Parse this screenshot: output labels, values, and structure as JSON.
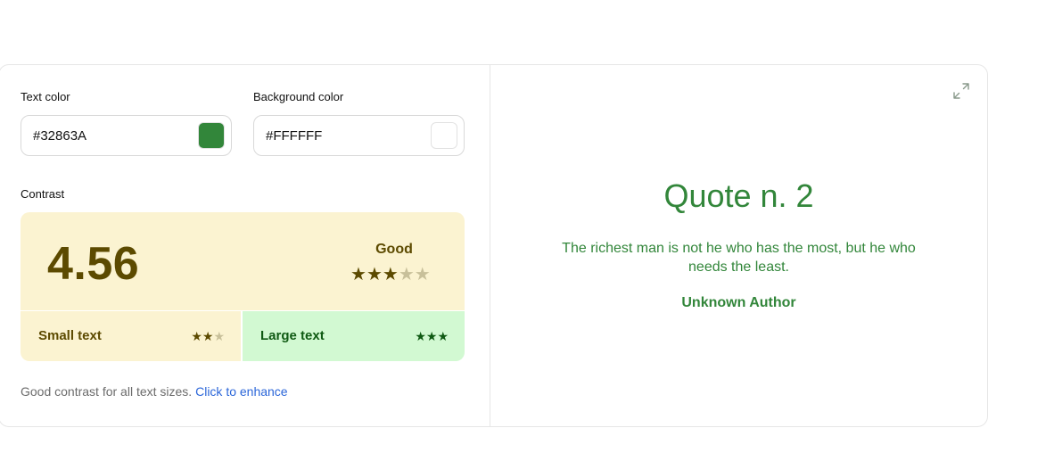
{
  "inputs": {
    "text_color_label": "Text color",
    "text_color_value": "#32863A",
    "text_color_swatch": "#32863A",
    "background_color_label": "Background color",
    "background_color_value": "#FFFFFF",
    "background_color_swatch": "#FFFFFF"
  },
  "contrast": {
    "label": "Contrast",
    "ratio": "4.56",
    "rating_label": "Good",
    "stars_filled": 3,
    "stars_total": 5,
    "small_text_label": "Small text",
    "small_text_stars_filled": 2,
    "small_text_stars_total": 3,
    "large_text_label": "Large text",
    "large_text_stars_filled": 3,
    "large_text_stars_total": 3,
    "colors": {
      "warn_bg": "#fbf3d1",
      "warn_fg": "#5c4a00",
      "ok_bg": "#d2f9d2",
      "ok_fg": "#0f5a13",
      "star_empty": "#c8c09a"
    }
  },
  "footer": {
    "message": "Good contrast for all text sizes.",
    "link_label": "Click to enhance"
  },
  "preview": {
    "expand_icon": "expand-icon",
    "title": "Quote n. 2",
    "quote": "The richest man is not he who has the most, but he who needs the least.",
    "author": "Unknown Author"
  }
}
